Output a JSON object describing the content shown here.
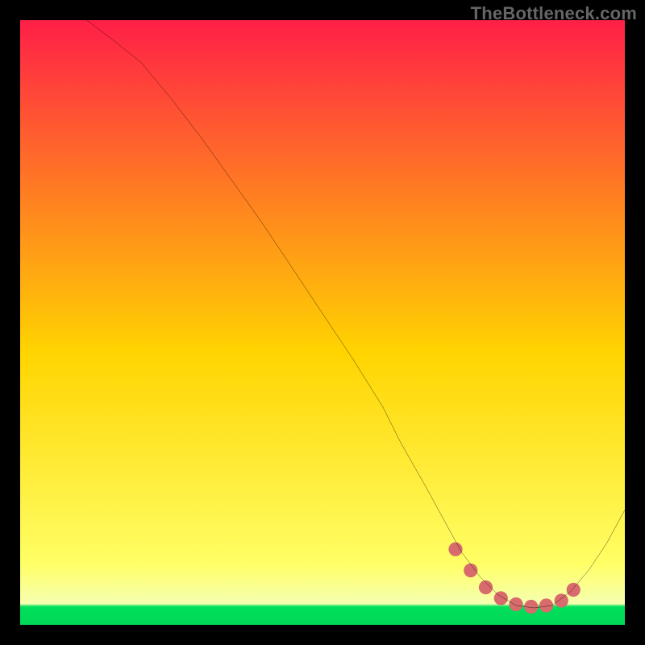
{
  "watermark": "TheBottleneck.com",
  "colors": {
    "page_bg": "#000000",
    "grad_top": "#ff1f47",
    "grad_mid": "#ffd400",
    "grad_bottom_yellow": "#ffff66",
    "grad_green": "#00e05a",
    "curve": "#000000",
    "marker": "#d86b6b"
  },
  "chart_data": {
    "type": "line",
    "title": "",
    "xlabel": "",
    "ylabel": "",
    "xlim": [
      0,
      100
    ],
    "ylim": [
      0,
      100
    ],
    "grid": false,
    "legend": false,
    "series": [
      {
        "name": "bottleneck-curve",
        "x": [
          11,
          15,
          20,
          25,
          30,
          35,
          40,
          45,
          50,
          55,
          60,
          63,
          67,
          70,
          73,
          76,
          79,
          82,
          85,
          88,
          91,
          94,
          97,
          100
        ],
        "y": [
          100,
          97,
          93,
          87,
          80.5,
          73.5,
          66.5,
          59,
          51.5,
          44,
          36,
          30,
          23,
          17.5,
          12,
          8,
          5,
          3.2,
          2.8,
          3.2,
          5.5,
          9,
          13.5,
          19
        ]
      }
    ],
    "highlight_band": {
      "name": "optimal-range-markers",
      "x": [
        72,
        74.5,
        77,
        79.5,
        82,
        84.5,
        87,
        89.5,
        91.5
      ],
      "y": [
        12.5,
        9,
        6.2,
        4.4,
        3.4,
        3.0,
        3.2,
        4.0,
        5.8
      ]
    }
  }
}
